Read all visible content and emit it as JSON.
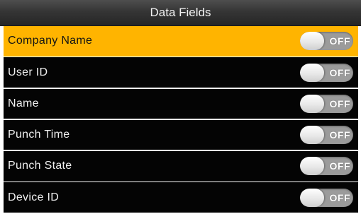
{
  "header": {
    "title": "Data Fields"
  },
  "fields": [
    {
      "label": "Company Name",
      "state": "OFF",
      "selected": true
    },
    {
      "label": "User ID",
      "state": "OFF",
      "selected": false
    },
    {
      "label": "Name",
      "state": "OFF",
      "selected": false
    },
    {
      "label": "Punch Time",
      "state": "OFF",
      "selected": false
    },
    {
      "label": "Punch State",
      "state": "OFF",
      "selected": false
    },
    {
      "label": "Device ID",
      "state": "OFF",
      "selected": false
    }
  ],
  "colors": {
    "selected_row": "#ffb400",
    "row_background": "#040404",
    "toggle_off": "#9b9b9b",
    "title_bar": "#353535"
  }
}
